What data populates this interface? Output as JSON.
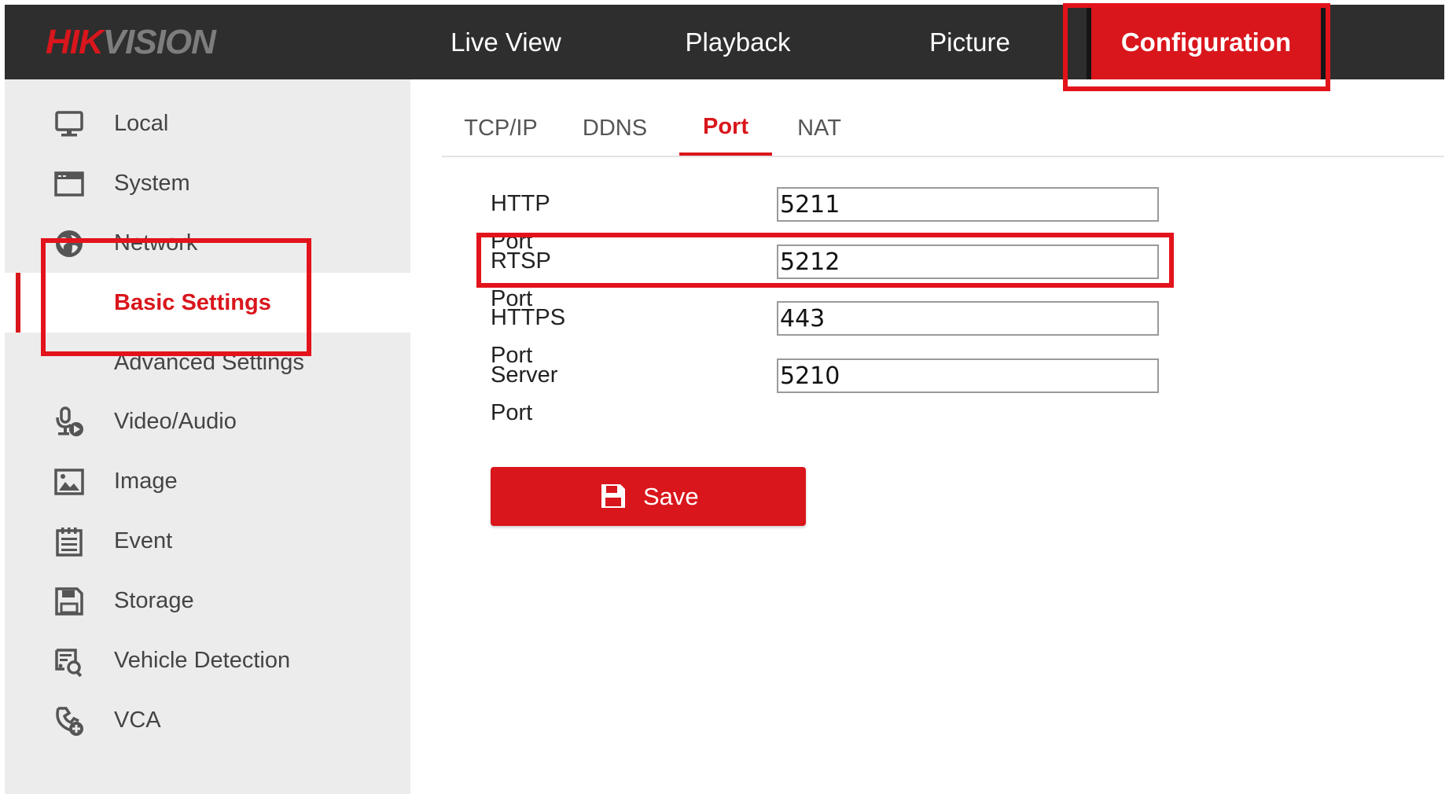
{
  "header": {
    "logo_part1": "HIK",
    "logo_part2": "VISION",
    "nav": [
      {
        "label": "Live View"
      },
      {
        "label": "Playback"
      },
      {
        "label": "Picture"
      },
      {
        "label": "Configuration",
        "active": true
      }
    ]
  },
  "sidebar": {
    "items": [
      {
        "label": "Local",
        "icon": "monitor-icon"
      },
      {
        "label": "System",
        "icon": "system-window-icon"
      },
      {
        "label": "Network",
        "icon": "globe-icon"
      },
      {
        "label": "Video/Audio",
        "icon": "microphone-icon"
      },
      {
        "label": "Image",
        "icon": "image-icon"
      },
      {
        "label": "Event",
        "icon": "calendar-icon"
      },
      {
        "label": "Storage",
        "icon": "floppy-disk-icon"
      },
      {
        "label": "Vehicle Detection",
        "icon": "vehicle-search-icon"
      },
      {
        "label": "VCA",
        "icon": "vca-icon"
      }
    ],
    "network_sub": [
      {
        "label": "Basic Settings",
        "active": true
      },
      {
        "label": "Advanced Settings"
      }
    ]
  },
  "tabs": [
    {
      "label": "TCP/IP"
    },
    {
      "label": "DDNS"
    },
    {
      "label": "Port",
      "active": true
    },
    {
      "label": "NAT"
    }
  ],
  "form": {
    "http_port": {
      "label": "HTTP Port",
      "value": "5211"
    },
    "rtsp_port": {
      "label": "RTSP Port",
      "value": "5212"
    },
    "https_port": {
      "label": "HTTPS Port",
      "value": "443"
    },
    "server_port": {
      "label": "Server Port",
      "value": "5210"
    }
  },
  "save_button": {
    "label": "Save",
    "icon": "save-icon"
  },
  "colors": {
    "accent": "#d9161c",
    "topbar": "#2e2e2e",
    "sidebar": "#ececec",
    "highlight_box": "#e3131b"
  }
}
